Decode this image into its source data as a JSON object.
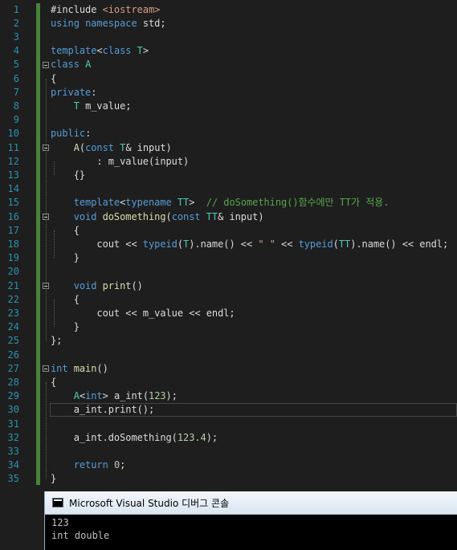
{
  "editor": {
    "lines": [
      {
        "n": "1",
        "segs": [
          {
            "t": "#include ",
            "c": ""
          },
          {
            "t": "<iostream>",
            "c": "st"
          }
        ]
      },
      {
        "n": "2",
        "segs": [
          {
            "t": "using ",
            "c": "kw"
          },
          {
            "t": "namespace ",
            "c": "kw"
          },
          {
            "t": "std;",
            "c": ""
          }
        ]
      },
      {
        "n": "3",
        "segs": []
      },
      {
        "n": "4",
        "segs": [
          {
            "t": "template",
            "c": "kw"
          },
          {
            "t": "<",
            "c": ""
          },
          {
            "t": "class ",
            "c": "kw"
          },
          {
            "t": "T",
            "c": "ty"
          },
          {
            "t": ">",
            "c": ""
          }
        ]
      },
      {
        "n": "5",
        "segs": [
          {
            "t": "class ",
            "c": "kw"
          },
          {
            "t": "A",
            "c": "ty"
          }
        ]
      },
      {
        "n": "6",
        "segs": [
          {
            "t": "{",
            "c": ""
          }
        ]
      },
      {
        "n": "7",
        "segs": [
          {
            "t": "private",
            "c": "kw"
          },
          {
            "t": ":",
            "c": ""
          }
        ]
      },
      {
        "n": "8",
        "segs": [
          {
            "t": "    ",
            "c": ""
          },
          {
            "t": "T ",
            "c": "ty"
          },
          {
            "t": "m_value;",
            "c": ""
          }
        ]
      },
      {
        "n": "9",
        "segs": []
      },
      {
        "n": "10",
        "segs": [
          {
            "t": "public",
            "c": "kw"
          },
          {
            "t": ":",
            "c": ""
          }
        ]
      },
      {
        "n": "11",
        "segs": [
          {
            "t": "    ",
            "c": ""
          },
          {
            "t": "A",
            "c": "fn"
          },
          {
            "t": "(",
            "c": ""
          },
          {
            "t": "const ",
            "c": "kw"
          },
          {
            "t": "T",
            "c": "ty"
          },
          {
            "t": "& input)",
            "c": ""
          }
        ]
      },
      {
        "n": "12",
        "segs": [
          {
            "t": "        : m_value(input)",
            "c": ""
          }
        ]
      },
      {
        "n": "13",
        "segs": [
          {
            "t": "    {}",
            "c": ""
          }
        ]
      },
      {
        "n": "14",
        "segs": []
      },
      {
        "n": "15",
        "segs": [
          {
            "t": "    ",
            "c": ""
          },
          {
            "t": "template",
            "c": "kw"
          },
          {
            "t": "<",
            "c": ""
          },
          {
            "t": "typename ",
            "c": "kw"
          },
          {
            "t": "TT",
            "c": "ty"
          },
          {
            "t": ">  ",
            "c": ""
          },
          {
            "t": "// doSomething()함수에만 TT가 적용.",
            "c": "cm"
          }
        ]
      },
      {
        "n": "16",
        "segs": [
          {
            "t": "    ",
            "c": ""
          },
          {
            "t": "void ",
            "c": "kw"
          },
          {
            "t": "doSomething",
            "c": "fn"
          },
          {
            "t": "(",
            "c": ""
          },
          {
            "t": "const ",
            "c": "kw"
          },
          {
            "t": "TT",
            "c": "ty"
          },
          {
            "t": "& input)",
            "c": ""
          }
        ]
      },
      {
        "n": "17",
        "segs": [
          {
            "t": "    {",
            "c": ""
          }
        ]
      },
      {
        "n": "18",
        "segs": [
          {
            "t": "        cout << ",
            "c": ""
          },
          {
            "t": "typeid",
            "c": "kw"
          },
          {
            "t": "(",
            "c": ""
          },
          {
            "t": "T",
            "c": "ty"
          },
          {
            "t": ").name() << ",
            "c": ""
          },
          {
            "t": "\" \"",
            "c": "st"
          },
          {
            "t": " << ",
            "c": ""
          },
          {
            "t": "typeid",
            "c": "kw"
          },
          {
            "t": "(",
            "c": ""
          },
          {
            "t": "TT",
            "c": "ty"
          },
          {
            "t": ").name() << endl;",
            "c": ""
          }
        ]
      },
      {
        "n": "19",
        "segs": [
          {
            "t": "    }",
            "c": ""
          }
        ]
      },
      {
        "n": "20",
        "segs": []
      },
      {
        "n": "21",
        "segs": [
          {
            "t": "    ",
            "c": ""
          },
          {
            "t": "void ",
            "c": "kw"
          },
          {
            "t": "print",
            "c": "fn"
          },
          {
            "t": "()",
            "c": ""
          }
        ]
      },
      {
        "n": "22",
        "segs": [
          {
            "t": "    {",
            "c": ""
          }
        ]
      },
      {
        "n": "23",
        "segs": [
          {
            "t": "        cout << m_value << endl;",
            "c": ""
          }
        ]
      },
      {
        "n": "24",
        "segs": [
          {
            "t": "    }",
            "c": ""
          }
        ]
      },
      {
        "n": "25",
        "segs": [
          {
            "t": "};",
            "c": ""
          }
        ]
      },
      {
        "n": "26",
        "segs": []
      },
      {
        "n": "27",
        "segs": [
          {
            "t": "int ",
            "c": "kw"
          },
          {
            "t": "main",
            "c": "fn"
          },
          {
            "t": "()",
            "c": ""
          }
        ]
      },
      {
        "n": "28",
        "segs": [
          {
            "t": "{",
            "c": ""
          }
        ]
      },
      {
        "n": "29",
        "segs": [
          {
            "t": "    ",
            "c": ""
          },
          {
            "t": "A",
            "c": "ty"
          },
          {
            "t": "<",
            "c": ""
          },
          {
            "t": "int",
            "c": "kw"
          },
          {
            "t": "> a_int(",
            "c": ""
          },
          {
            "t": "123",
            "c": "nm"
          },
          {
            "t": ");",
            "c": ""
          }
        ]
      },
      {
        "n": "30",
        "segs": [
          {
            "t": "    a_int.print();",
            "c": ""
          }
        ]
      },
      {
        "n": "31",
        "segs": []
      },
      {
        "n": "32",
        "segs": [
          {
            "t": "    a_int.doSomething(",
            "c": ""
          },
          {
            "t": "123.4",
            "c": "nm"
          },
          {
            "t": ");",
            "c": ""
          }
        ]
      },
      {
        "n": "33",
        "segs": []
      },
      {
        "n": "34",
        "segs": [
          {
            "t": "    ",
            "c": ""
          },
          {
            "t": "return ",
            "c": "kw"
          },
          {
            "t": "0",
            "c": "nm"
          },
          {
            "t": ";",
            "c": ""
          }
        ]
      },
      {
        "n": "35",
        "segs": [
          {
            "t": "}",
            "c": ""
          }
        ]
      }
    ],
    "fold_lines": [
      5,
      11,
      16,
      21,
      27
    ],
    "current_line": 30
  },
  "console": {
    "title": "Microsoft Visual Studio 디버그 콘솔",
    "icon": "console-window-icon",
    "output": [
      "123",
      "int double"
    ]
  },
  "colors": {
    "background": "#1e1e1e",
    "keyword": "#569cd6",
    "type": "#4ec9b0",
    "string": "#d69d85",
    "comment": "#57a64a",
    "line_number": "#2b91af"
  }
}
